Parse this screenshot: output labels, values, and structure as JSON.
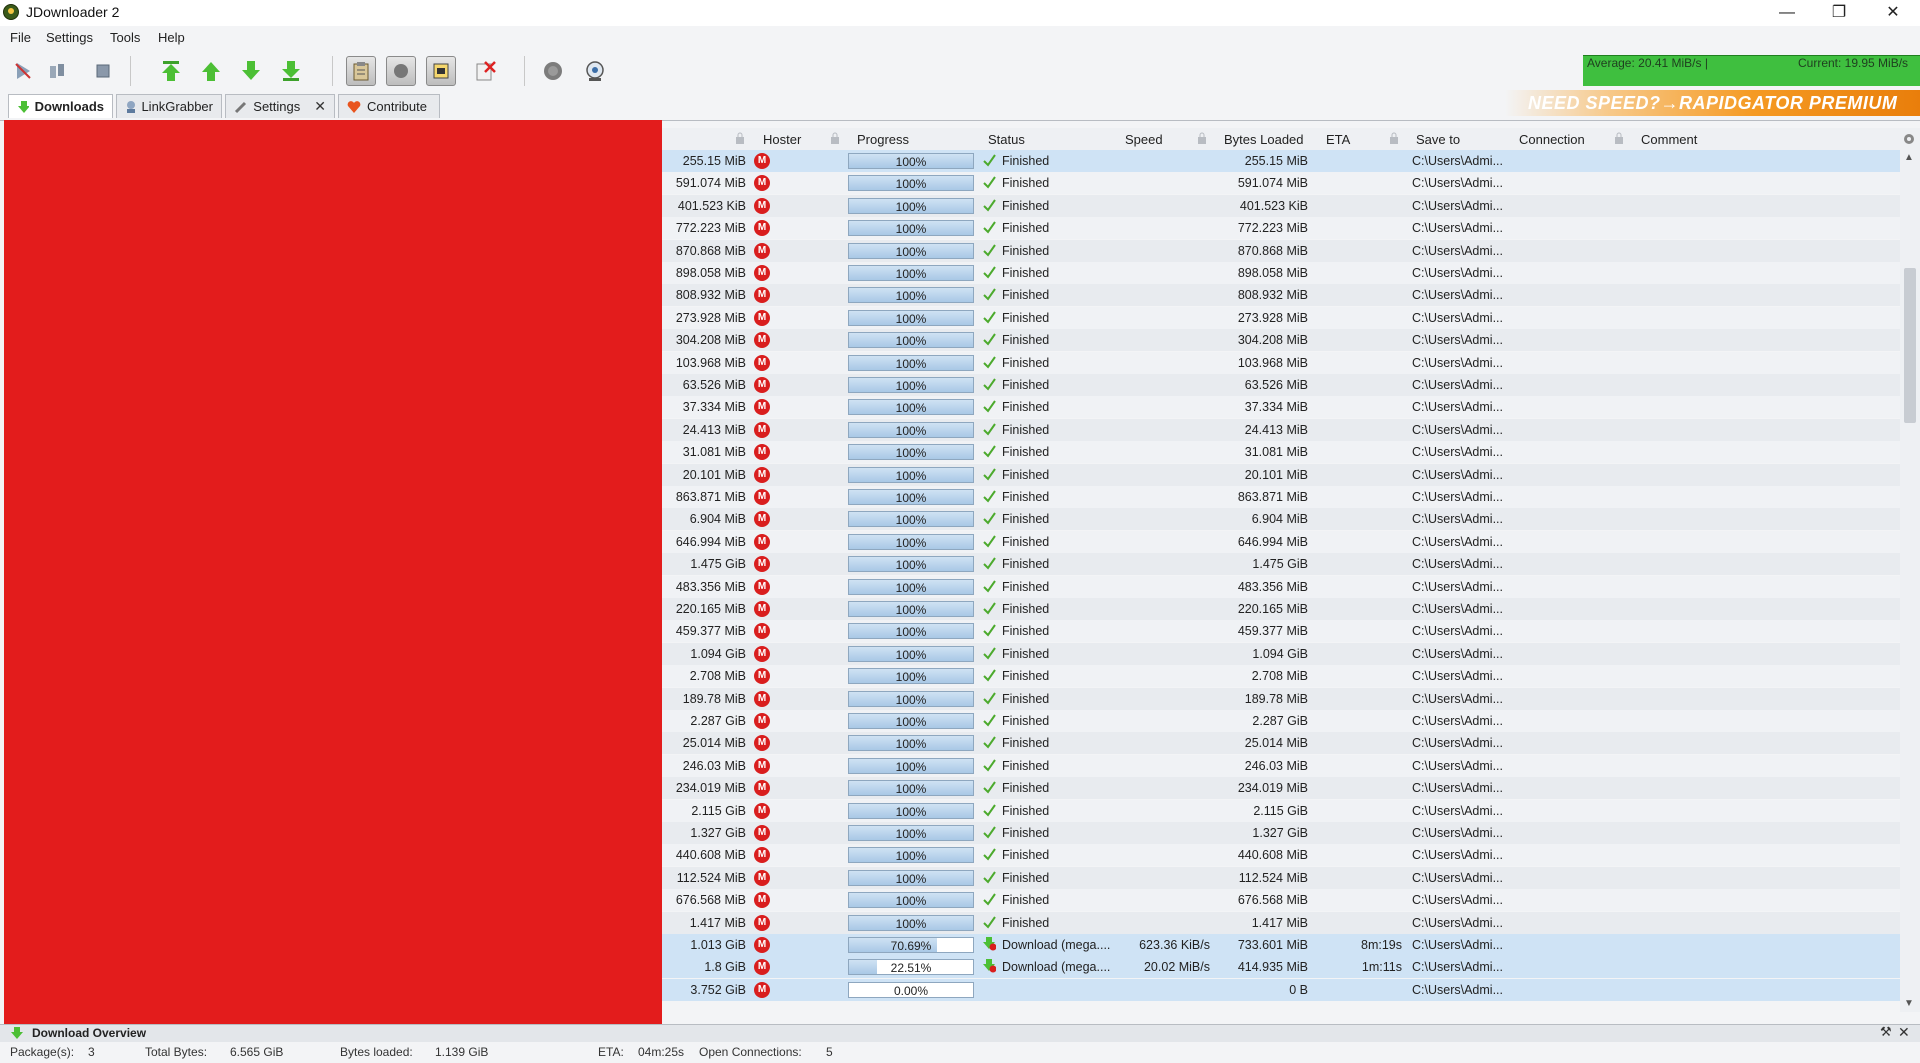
{
  "window": {
    "title": "JDownloader 2"
  },
  "menu": [
    "File",
    "Settings",
    "Tools",
    "Help"
  ],
  "toolbar": {
    "buttons": [
      "start-downloads-icon",
      "pause-downloads-icon",
      "stop-downloads-icon",
      "move-top-icon",
      "move-up-icon",
      "move-down-icon",
      "move-bottom-icon",
      "clipboard-observer-icon",
      "reconnect-icon",
      "auto-update-icon",
      "cleanup-icon",
      "silent-mode-icon",
      "premium-icon"
    ]
  },
  "speed": {
    "average": "Average: 20.41 MiB/s |",
    "current": "Current: 19.95 MiB/s"
  },
  "tabs": {
    "downloads": "Downloads",
    "linkgrabber": "LinkGrabber",
    "settings": "Settings",
    "contribute": "Contribute"
  },
  "banner": "NEED SPEED?→RAPIDGATOR PREMIUM",
  "columns": {
    "hoster": "Hoster",
    "progress": "Progress",
    "status": "Status",
    "speed": "Speed",
    "bytes_loaded": "Bytes Loaded",
    "eta": "ETA",
    "save_to": "Save to",
    "connection": "Connection",
    "comment": "Comment"
  },
  "rows": [
    {
      "size": "255.15 MiB",
      "progress": "100%",
      "pct": 1,
      "status": "Finished",
      "speed": "",
      "loaded": "255.15 MiB",
      "eta": "",
      "save": "C:\\Users\\Admi..."
    },
    {
      "size": "591.074 MiB",
      "progress": "100%",
      "pct": 1,
      "status": "Finished",
      "speed": "",
      "loaded": "591.074 MiB",
      "eta": "",
      "save": "C:\\Users\\Admi..."
    },
    {
      "size": "401.523 KiB",
      "progress": "100%",
      "pct": 1,
      "status": "Finished",
      "speed": "",
      "loaded": "401.523 KiB",
      "eta": "",
      "save": "C:\\Users\\Admi..."
    },
    {
      "size": "772.223 MiB",
      "progress": "100%",
      "pct": 1,
      "status": "Finished",
      "speed": "",
      "loaded": "772.223 MiB",
      "eta": "",
      "save": "C:\\Users\\Admi..."
    },
    {
      "size": "870.868 MiB",
      "progress": "100%",
      "pct": 1,
      "status": "Finished",
      "speed": "",
      "loaded": "870.868 MiB",
      "eta": "",
      "save": "C:\\Users\\Admi..."
    },
    {
      "size": "898.058 MiB",
      "progress": "100%",
      "pct": 1,
      "status": "Finished",
      "speed": "",
      "loaded": "898.058 MiB",
      "eta": "",
      "save": "C:\\Users\\Admi..."
    },
    {
      "size": "808.932 MiB",
      "progress": "100%",
      "pct": 1,
      "status": "Finished",
      "speed": "",
      "loaded": "808.932 MiB",
      "eta": "",
      "save": "C:\\Users\\Admi..."
    },
    {
      "size": "273.928 MiB",
      "progress": "100%",
      "pct": 1,
      "status": "Finished",
      "speed": "",
      "loaded": "273.928 MiB",
      "eta": "",
      "save": "C:\\Users\\Admi..."
    },
    {
      "size": "304.208 MiB",
      "progress": "100%",
      "pct": 1,
      "status": "Finished",
      "speed": "",
      "loaded": "304.208 MiB",
      "eta": "",
      "save": "C:\\Users\\Admi..."
    },
    {
      "size": "103.968 MiB",
      "progress": "100%",
      "pct": 1,
      "status": "Finished",
      "speed": "",
      "loaded": "103.968 MiB",
      "eta": "",
      "save": "C:\\Users\\Admi..."
    },
    {
      "size": "63.526 MiB",
      "progress": "100%",
      "pct": 1,
      "status": "Finished",
      "speed": "",
      "loaded": "63.526 MiB",
      "eta": "",
      "save": "C:\\Users\\Admi..."
    },
    {
      "size": "37.334 MiB",
      "progress": "100%",
      "pct": 1,
      "status": "Finished",
      "speed": "",
      "loaded": "37.334 MiB",
      "eta": "",
      "save": "C:\\Users\\Admi..."
    },
    {
      "size": "24.413 MiB",
      "progress": "100%",
      "pct": 1,
      "status": "Finished",
      "speed": "",
      "loaded": "24.413 MiB",
      "eta": "",
      "save": "C:\\Users\\Admi..."
    },
    {
      "size": "31.081 MiB",
      "progress": "100%",
      "pct": 1,
      "status": "Finished",
      "speed": "",
      "loaded": "31.081 MiB",
      "eta": "",
      "save": "C:\\Users\\Admi..."
    },
    {
      "size": "20.101 MiB",
      "progress": "100%",
      "pct": 1,
      "status": "Finished",
      "speed": "",
      "loaded": "20.101 MiB",
      "eta": "",
      "save": "C:\\Users\\Admi..."
    },
    {
      "size": "863.871 MiB",
      "progress": "100%",
      "pct": 1,
      "status": "Finished",
      "speed": "",
      "loaded": "863.871 MiB",
      "eta": "",
      "save": "C:\\Users\\Admi..."
    },
    {
      "size": "6.904 MiB",
      "progress": "100%",
      "pct": 1,
      "status": "Finished",
      "speed": "",
      "loaded": "6.904 MiB",
      "eta": "",
      "save": "C:\\Users\\Admi..."
    },
    {
      "size": "646.994 MiB",
      "progress": "100%",
      "pct": 1,
      "status": "Finished",
      "speed": "",
      "loaded": "646.994 MiB",
      "eta": "",
      "save": "C:\\Users\\Admi..."
    },
    {
      "size": "1.475 GiB",
      "progress": "100%",
      "pct": 1,
      "status": "Finished",
      "speed": "",
      "loaded": "1.475 GiB",
      "eta": "",
      "save": "C:\\Users\\Admi..."
    },
    {
      "size": "483.356 MiB",
      "progress": "100%",
      "pct": 1,
      "status": "Finished",
      "speed": "",
      "loaded": "483.356 MiB",
      "eta": "",
      "save": "C:\\Users\\Admi..."
    },
    {
      "size": "220.165 MiB",
      "progress": "100%",
      "pct": 1,
      "status": "Finished",
      "speed": "",
      "loaded": "220.165 MiB",
      "eta": "",
      "save": "C:\\Users\\Admi..."
    },
    {
      "size": "459.377 MiB",
      "progress": "100%",
      "pct": 1,
      "status": "Finished",
      "speed": "",
      "loaded": "459.377 MiB",
      "eta": "",
      "save": "C:\\Users\\Admi..."
    },
    {
      "size": "1.094 GiB",
      "progress": "100%",
      "pct": 1,
      "status": "Finished",
      "speed": "",
      "loaded": "1.094 GiB",
      "eta": "",
      "save": "C:\\Users\\Admi..."
    },
    {
      "size": "2.708 MiB",
      "progress": "100%",
      "pct": 1,
      "status": "Finished",
      "speed": "",
      "loaded": "2.708 MiB",
      "eta": "",
      "save": "C:\\Users\\Admi..."
    },
    {
      "size": "189.78 MiB",
      "progress": "100%",
      "pct": 1,
      "status": "Finished",
      "speed": "",
      "loaded": "189.78 MiB",
      "eta": "",
      "save": "C:\\Users\\Admi..."
    },
    {
      "size": "2.287 GiB",
      "progress": "100%",
      "pct": 1,
      "status": "Finished",
      "speed": "",
      "loaded": "2.287 GiB",
      "eta": "",
      "save": "C:\\Users\\Admi..."
    },
    {
      "size": "25.014 MiB",
      "progress": "100%",
      "pct": 1,
      "status": "Finished",
      "speed": "",
      "loaded": "25.014 MiB",
      "eta": "",
      "save": "C:\\Users\\Admi..."
    },
    {
      "size": "246.03 MiB",
      "progress": "100%",
      "pct": 1,
      "status": "Finished",
      "speed": "",
      "loaded": "246.03 MiB",
      "eta": "",
      "save": "C:\\Users\\Admi..."
    },
    {
      "size": "234.019 MiB",
      "progress": "100%",
      "pct": 1,
      "status": "Finished",
      "speed": "",
      "loaded": "234.019 MiB",
      "eta": "",
      "save": "C:\\Users\\Admi..."
    },
    {
      "size": "2.115 GiB",
      "progress": "100%",
      "pct": 1,
      "status": "Finished",
      "speed": "",
      "loaded": "2.115 GiB",
      "eta": "",
      "save": "C:\\Users\\Admi..."
    },
    {
      "size": "1.327 GiB",
      "progress": "100%",
      "pct": 1,
      "status": "Finished",
      "speed": "",
      "loaded": "1.327 GiB",
      "eta": "",
      "save": "C:\\Users\\Admi..."
    },
    {
      "size": "440.608 MiB",
      "progress": "100%",
      "pct": 1,
      "status": "Finished",
      "speed": "",
      "loaded": "440.608 MiB",
      "eta": "",
      "save": "C:\\Users\\Admi..."
    },
    {
      "size": "112.524 MiB",
      "progress": "100%",
      "pct": 1,
      "status": "Finished",
      "speed": "",
      "loaded": "112.524 MiB",
      "eta": "",
      "save": "C:\\Users\\Admi..."
    },
    {
      "size": "676.568 MiB",
      "progress": "100%",
      "pct": 1,
      "status": "Finished",
      "speed": "",
      "loaded": "676.568 MiB",
      "eta": "",
      "save": "C:\\Users\\Admi..."
    },
    {
      "size": "1.417 MiB",
      "progress": "100%",
      "pct": 1,
      "status": "Finished",
      "speed": "",
      "loaded": "1.417 MiB",
      "eta": "",
      "save": "C:\\Users\\Admi..."
    },
    {
      "size": "1.013 GiB",
      "progress": "70.69%",
      "pct": 0.7069,
      "status": "Download (mega....",
      "speed": "623.36 KiB/s",
      "loaded": "733.601 MiB",
      "eta": "8m:19s",
      "save": "C:\\Users\\Admi...",
      "active": true
    },
    {
      "size": "1.8 GiB",
      "progress": "22.51%",
      "pct": 0.2251,
      "status": "Download (mega....",
      "speed": "20.02 MiB/s",
      "loaded": "414.935 MiB",
      "eta": "1m:11s",
      "save": "C:\\Users\\Admi...",
      "active": true
    },
    {
      "size": "3.752 GiB",
      "progress": "0.00%",
      "pct": 0,
      "status": "",
      "speed": "",
      "loaded": "0 B",
      "eta": "",
      "save": "C:\\Users\\Admi..."
    }
  ],
  "overview": {
    "title": "Download Overview"
  },
  "statusbar": {
    "packages_label": "Package(s):",
    "packages": "3",
    "total_label": "Total Bytes:",
    "total": "6.565 GiB",
    "loaded_label": "Bytes loaded:",
    "loaded": "1.139 GiB",
    "eta_label": "ETA:",
    "eta": "04m:25s",
    "conn_label": "Open Connections:",
    "conn": "5"
  },
  "colors": {
    "accent_green": "#3fbf3f",
    "hoster_red": "#d91e1e",
    "selection_blue": "#cfe3f5",
    "redaction": "#e31c1c"
  }
}
